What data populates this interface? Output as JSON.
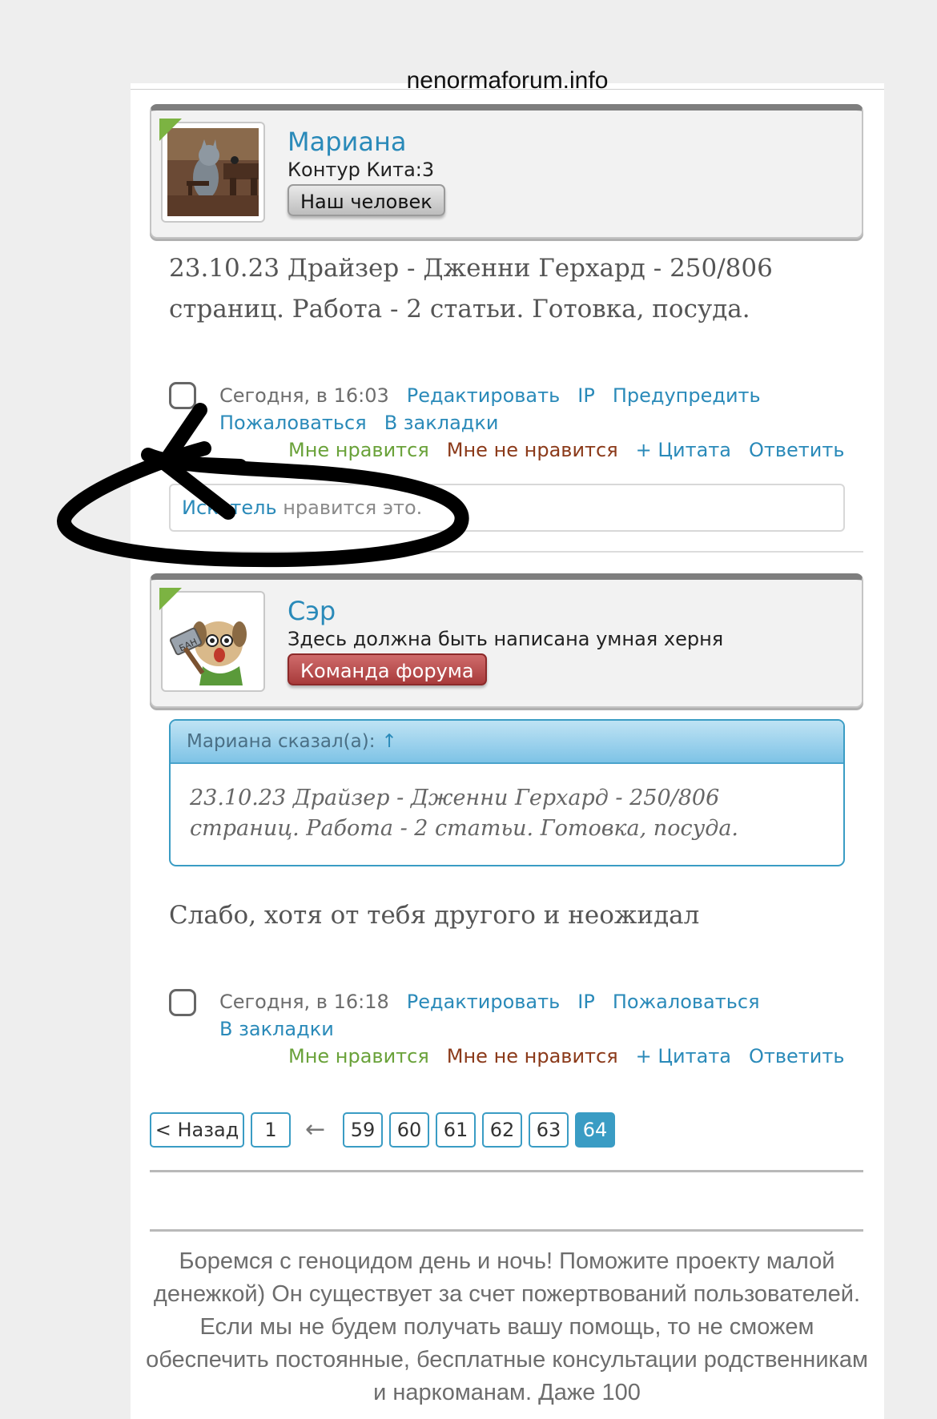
{
  "browser": {
    "url": "nenormaforum.info"
  },
  "posts": [
    {
      "username": "Мариана",
      "usertitle": "Контур Кита:3",
      "rank": "Наш человек",
      "text": "23.10.23 Драйзер - Дженни Герхард - 250/806 страниц. Работа - 2 статьи. Готовка, посуда.",
      "date": "Сегодня, в 16:03",
      "actions_row1": [
        "Редактировать",
        "IP",
        "Предупредить"
      ],
      "actions_row2": [
        "Пожаловаться",
        "В закладки"
      ],
      "like": "Мне нравится",
      "dislike": "Мне не нравится",
      "quote": "+ Цитата",
      "reply": "Ответить",
      "liked_by_user": "Искатель",
      "liked_by_suffix": " нравится это."
    },
    {
      "username": "Сэр",
      "usertitle": "Здесь должна быть написана умная херня",
      "rank": "Команда форума",
      "quote_header": "Мариана сказал(а):",
      "quote_arrow": "↑",
      "quote_text": "23.10.23 Драйзер - Дженни Герхард - 250/806 страниц. Работа - 2 статьи. Готовка, посуда.",
      "text": "Слабо, хотя от тебя другого и неожидал",
      "date": "Сегодня, в 16:18",
      "actions_row1": [
        "Редактировать",
        "IP",
        "Пожаловаться"
      ],
      "actions_row2": [
        "В закладки"
      ],
      "like": "Мне нравится",
      "dislike": "Мне не нравится",
      "quote": "+ Цитата",
      "reply": "Ответить"
    }
  ],
  "pagination": {
    "prev": "< Назад",
    "first": "1",
    "ellipsis_arrow": "←",
    "pages": [
      "59",
      "60",
      "61",
      "62",
      "63"
    ],
    "current": "64"
  },
  "donate_text": "Боремся с геноцидом день и ночь! Поможите проекту малой денежкой) Он существует за счет пожертвований пользователей. Если мы не будем получать вашу помощь, то не сможем обеспечить постоянные, бесплатные консультации родственникам и наркоманам. Даже 100",
  "colors": {
    "link": "#2a8ab9",
    "like": "#6aa23a",
    "dislike": "#8b3a1a",
    "online": "#7cb342",
    "annotation": "#000000"
  }
}
